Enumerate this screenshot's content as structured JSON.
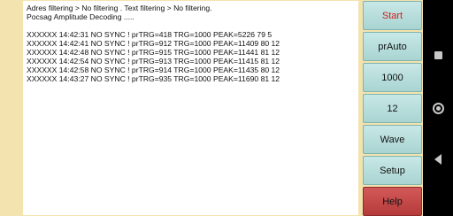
{
  "log": {
    "filter_line": "Adres filtering > No filtering . Text filtering > No filtering.",
    "mode_line": "Pocsag Amplitude Decoding .....",
    "entries": [
      "XXXXXX 14:42:31 NO SYNC ! prTRG=418 TRG=1000 PEAK=5226 79 5",
      "XXXXXX 14:42:41 NO SYNC ! prTRG=912 TRG=1000 PEAK=11409 80 12",
      "XXXXXX 14:42:48 NO SYNC ! prTRG=915 TRG=1000 PEAK=11441 81 12",
      "XXXXXX 14:42:54 NO SYNC ! prTRG=913 TRG=1000 PEAK=11415 81 12",
      "XXXXXX 14:42:58 NO SYNC ! prTRG=914 TRG=1000 PEAK=11435 80 12",
      "XXXXXX 14:43:27 NO SYNC ! prTRG=935 TRG=1000 PEAK=11690 81 12"
    ]
  },
  "buttons": {
    "start": "Start",
    "prauto": "prAuto",
    "value_1000": "1000",
    "value_12": "12",
    "wave": "Wave",
    "setup": "Setup",
    "help": "Help"
  },
  "navbar": {
    "recent_icon": "square-icon",
    "home_icon": "circle-icon",
    "back_icon": "triangle-left-icon"
  },
  "colors": {
    "background": "#f3e3ae",
    "button": "#b8dedc",
    "start_text": "#d02020",
    "help_button": "#c44a4a"
  }
}
